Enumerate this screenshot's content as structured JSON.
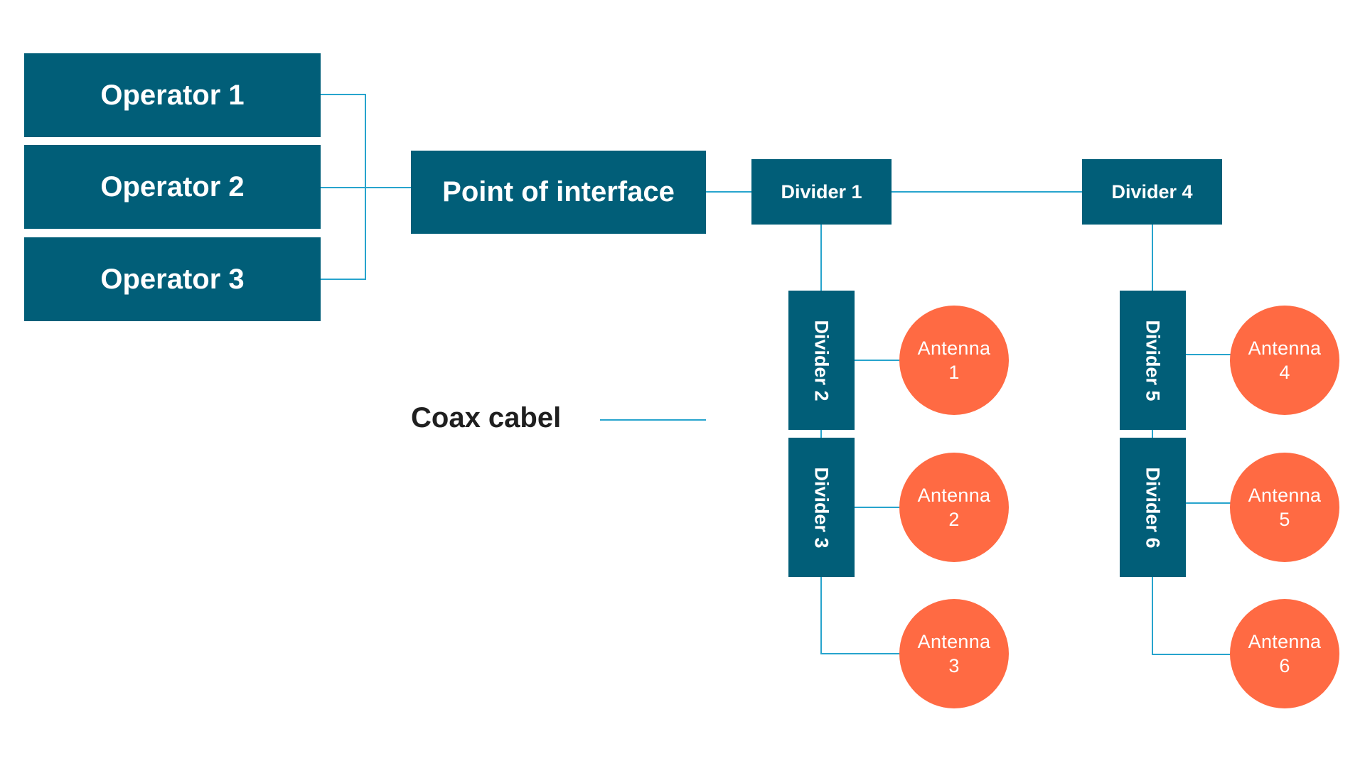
{
  "colors": {
    "box": "#015e78",
    "antenna": "#ff6a43",
    "cable": "#27a4cd",
    "text_light": "#ffffff",
    "text_dark": "#1f1f1f"
  },
  "operators": [
    {
      "label": "Operator 1"
    },
    {
      "label": "Operator 2"
    },
    {
      "label": "Operator 3"
    }
  ],
  "point_of_interface": {
    "label": "Point of interface"
  },
  "dividers": [
    {
      "label": "Divider 1"
    },
    {
      "label": "Divider 2"
    },
    {
      "label": "Divider 3"
    },
    {
      "label": "Divider 4"
    },
    {
      "label": "Divider 5"
    },
    {
      "label": "Divider 6"
    }
  ],
  "antennas": [
    {
      "line1": "Antenna",
      "line2": "1"
    },
    {
      "line1": "Antenna",
      "line2": "2"
    },
    {
      "line1": "Antenna",
      "line2": "3"
    },
    {
      "line1": "Antenna",
      "line2": "4"
    },
    {
      "line1": "Antenna",
      "line2": "5"
    },
    {
      "line1": "Antenna",
      "line2": "6"
    }
  ],
  "legend": {
    "label": "Coax cabel"
  },
  "connections": [
    [
      "Operator 1",
      "Point of interface"
    ],
    [
      "Operator 2",
      "Point of interface"
    ],
    [
      "Operator 3",
      "Point of interface"
    ],
    [
      "Point of interface",
      "Divider 1"
    ],
    [
      "Divider 1",
      "Divider 4"
    ],
    [
      "Divider 1",
      "Divider 2"
    ],
    [
      "Divider 2",
      "Divider 3"
    ],
    [
      "Divider 2",
      "Antenna 1"
    ],
    [
      "Divider 3",
      "Antenna 2"
    ],
    [
      "Divider 3",
      "Antenna 3"
    ],
    [
      "Divider 4",
      "Divider 5"
    ],
    [
      "Divider 5",
      "Divider 6"
    ],
    [
      "Divider 5",
      "Antenna 4"
    ],
    [
      "Divider 6",
      "Antenna 5"
    ],
    [
      "Divider 6",
      "Antenna 6"
    ]
  ]
}
